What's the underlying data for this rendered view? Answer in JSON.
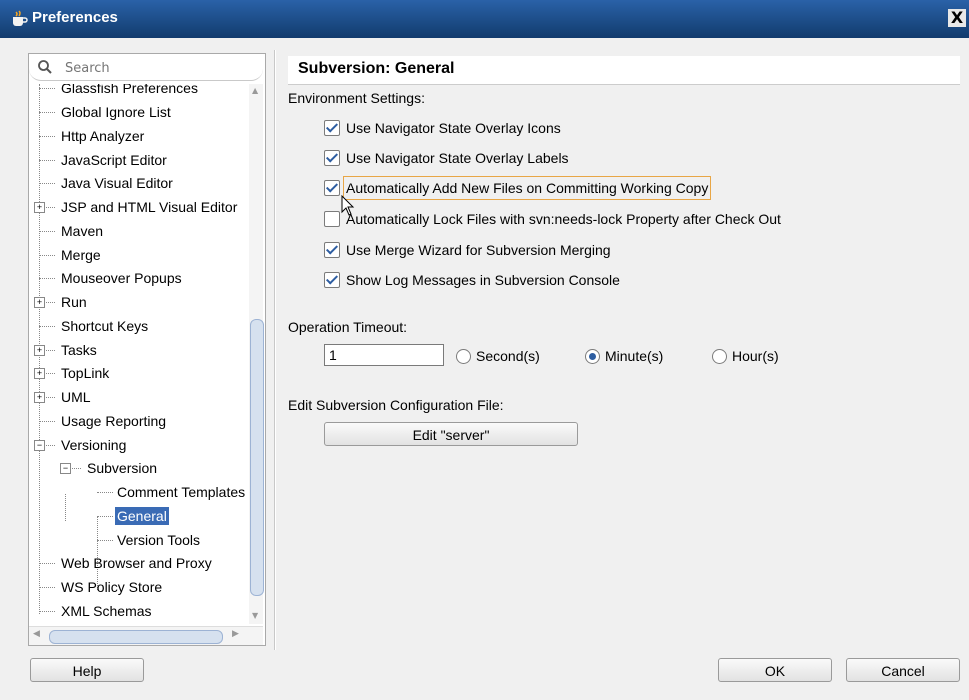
{
  "window": {
    "title": "Preferences",
    "close_label": "X"
  },
  "search": {
    "placeholder": "Search"
  },
  "tree": {
    "items": [
      {
        "label": "Glassfish Preferences"
      },
      {
        "label": "Global Ignore List"
      },
      {
        "label": "Http Analyzer"
      },
      {
        "label": "JavaScript Editor"
      },
      {
        "label": "Java Visual Editor"
      },
      {
        "label": "JSP and HTML Visual Editor"
      },
      {
        "label": "Maven"
      },
      {
        "label": "Merge"
      },
      {
        "label": "Mouseover Popups"
      },
      {
        "label": "Run"
      },
      {
        "label": "Shortcut Keys"
      },
      {
        "label": "Tasks"
      },
      {
        "label": "TopLink"
      },
      {
        "label": "UML"
      },
      {
        "label": "Usage Reporting"
      },
      {
        "label": "Versioning"
      },
      {
        "label": "Subversion"
      },
      {
        "label": "Comment Templates"
      },
      {
        "label": "General"
      },
      {
        "label": "Version Tools"
      },
      {
        "label": "Web Browser and Proxy"
      },
      {
        "label": "WS Policy Store"
      },
      {
        "label": "XML Schemas"
      }
    ],
    "selected": "General"
  },
  "content": {
    "title": "Subversion: General",
    "env_label": "Environment Settings:",
    "checkboxes": [
      {
        "label": "Use Navigator State Overlay Icons",
        "checked": true
      },
      {
        "label": "Use Navigator State Overlay Labels",
        "checked": true
      },
      {
        "label": "Automatically Add New Files on Committing Working Copy",
        "checked": true
      },
      {
        "label": "Automatically Lock Files with svn:needs-lock Property after Check Out",
        "checked": false
      },
      {
        "label": "Use Merge Wizard for Subversion Merging",
        "checked": true
      },
      {
        "label": "Show Log Messages in Subversion Console",
        "checked": true
      }
    ],
    "timeout_label": "Operation Timeout:",
    "timeout_value": "1",
    "radios": [
      {
        "label": "Second(s)",
        "selected": false
      },
      {
        "label": "Minute(s)",
        "selected": true
      },
      {
        "label": "Hour(s)",
        "selected": false
      }
    ],
    "config_label": "Edit Subversion Configuration File:",
    "edit_button": "Edit \"server\""
  },
  "footer": {
    "help": "Help",
    "ok": "OK",
    "cancel": "Cancel"
  }
}
